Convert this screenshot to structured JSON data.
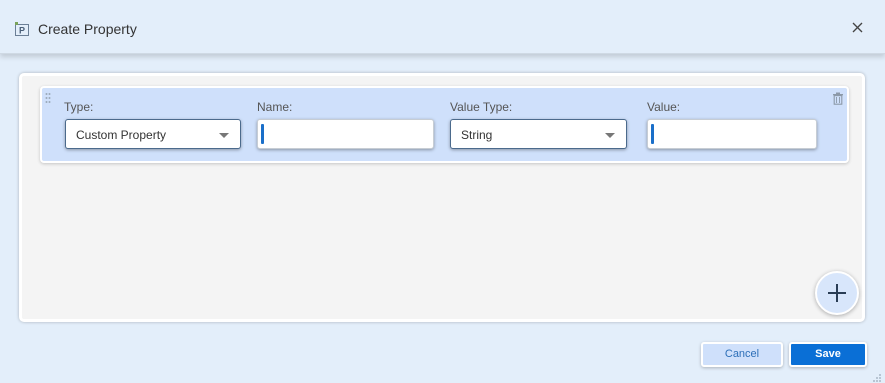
{
  "dialog": {
    "title": "Create Property",
    "title_icon": "property-p-icon",
    "close_icon": "close-icon"
  },
  "row": {
    "type_label": "Type:",
    "type_value": "Custom Property",
    "name_label": "Name:",
    "name_value": "",
    "value_type_label": "Value Type:",
    "value_type_value": "String",
    "value_label": "Value:",
    "value_value": "",
    "drag_icon": "drag-handle-icon",
    "delete_icon": "trash-icon"
  },
  "add_icon": "plus-icon",
  "footer": {
    "cancel_label": "Cancel",
    "save_label": "Save"
  },
  "colors": {
    "background": "#e3eefa",
    "row_bg": "#cfe0fb",
    "accent": "#0a6fd6"
  }
}
